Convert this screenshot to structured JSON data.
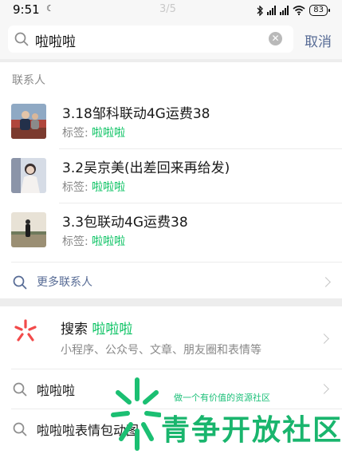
{
  "status_bar": {
    "time": "9:51",
    "page_indicator": "3/5",
    "battery": "83"
  },
  "search": {
    "query": "啦啦啦",
    "cancel_label": "取消"
  },
  "contacts": {
    "section_title": "联系人",
    "tag_prefix": "标签: ",
    "items": [
      {
        "name": "3.18邹科联动4G运费38",
        "tag": "啦啦啦"
      },
      {
        "name": "3.2吴京美(出差回来再给发)",
        "tag": "啦啦啦"
      },
      {
        "name": "3.3包联动4G运费38",
        "tag": "啦啦啦"
      }
    ],
    "more_label": "更多联系人"
  },
  "web_search": {
    "title_prefix": "搜索 ",
    "query": "啦啦啦",
    "subtitle": "小程序、公众号、文章、朋友圈和表情等",
    "suggestions": [
      "啦啦啦",
      "啦啦啦表情包动图"
    ]
  },
  "watermark": {
    "tagline": "做一个有价值的资源社区",
    "title": "青争开放社区"
  },
  "colors": {
    "accent_green": "#07c160",
    "link_blue": "#576b95"
  }
}
